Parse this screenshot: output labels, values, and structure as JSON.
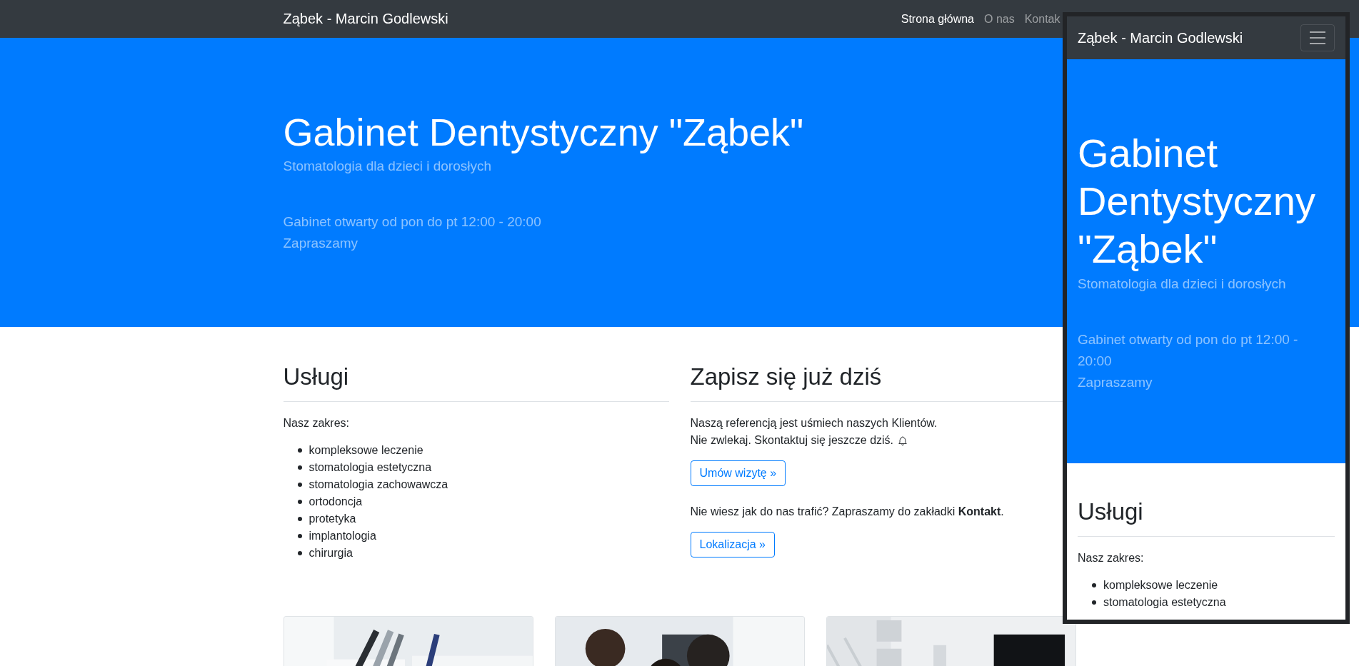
{
  "navbar": {
    "brand": "Ząbek - Marcin Godlewski",
    "links": [
      {
        "label": "Strona główna",
        "selected": true
      },
      {
        "label": "O nas",
        "selected": false
      },
      {
        "label": "Kontak",
        "selected": false
      }
    ]
  },
  "hero": {
    "title": "Gabinet Dentystyczny \"Ząbek\"",
    "subtitle": "Stomatologia dla dzieci i dorosłych",
    "hours": "Gabinet otwarty od pon do pt 12:00 - 20:00",
    "invite": "Zapraszamy"
  },
  "services": {
    "heading": "Usługi",
    "intro": "Nasz zakres:",
    "items": [
      "kompleksowe leczenie",
      "stomatologia estetyczna",
      "stomatologia zachowawcza",
      "ortodoncja",
      "protetyka",
      "implantologia",
      "chirurgia"
    ]
  },
  "signup": {
    "heading": "Zapisz się już dziś",
    "lines": [
      "Naszą referencją jest uśmiech naszych Klientów.",
      "Nie zwlekaj. Skontaktuj się jeszcze dziś."
    ],
    "appointment_button": "Umów wizytę »",
    "directions": "Nie wiesz jak do nas trafić? Zapraszamy do zakładki **Kontakt**.",
    "location_button": "Lokalizacja »"
  },
  "mobile_preview": {
    "brand": "Ząbek - Marcin Godlewski",
    "hero": {
      "title": "Gabinet Dentystyczny \"Ząbek\"",
      "subtitle": "Stomatologia dla dzieci i dorosłych",
      "hours": "Gabinet otwarty od pon do pt 12:00 - 20:00",
      "invite": "Zapraszamy"
    },
    "services": {
      "heading": "Usługi",
      "intro": "Nasz zakres:",
      "items": [
        "kompleksowe leczenie",
        "stomatologia estetyczna"
      ]
    }
  }
}
